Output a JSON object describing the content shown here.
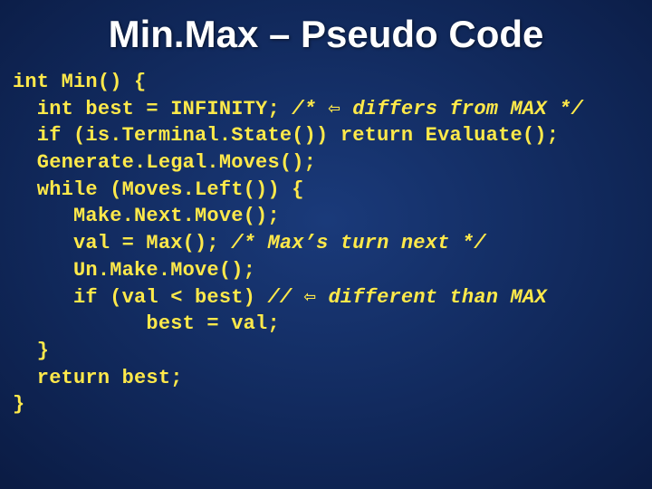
{
  "title": "Min.Max – Pseudo Code",
  "code": {
    "l0": "int Min() {",
    "l1a": "  int best = INFINITY; ",
    "l1b": "/* ⇦ differs from MAX */",
    "l2": "  if (is.Terminal.State()) return Evaluate();",
    "l3": "  Generate.Legal.Moves();",
    "l4": "  while (Moves.Left()) {",
    "l5": "     Make.Next.Move();",
    "l6a": "     val = Max(); ",
    "l6b": "/* Max’s turn next */",
    "l7": "     Un.Make.Move();",
    "l8a": "     if (val < best) ",
    "l8b": "// ⇦ different than MAX",
    "l9": "           best = val;",
    "l10": "  }",
    "l11": "  return best;",
    "l12": "}"
  }
}
